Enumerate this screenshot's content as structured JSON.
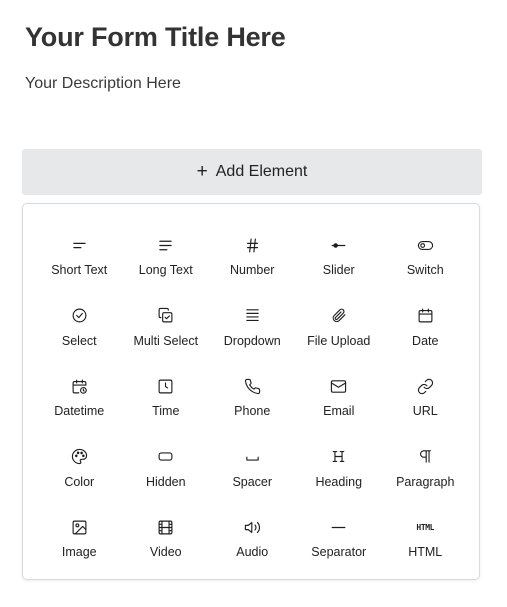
{
  "form": {
    "title": "Your Form Title Here",
    "description": "Your Description Here"
  },
  "add_element": {
    "icon": "plus-icon",
    "label": "Add Element",
    "background": "#e6e8e9"
  },
  "elements": [
    {
      "key": "short-text",
      "label": "Short Text",
      "icon": "short-text-icon"
    },
    {
      "key": "long-text",
      "label": "Long Text",
      "icon": "long-text-icon"
    },
    {
      "key": "number",
      "label": "Number",
      "icon": "hash-icon"
    },
    {
      "key": "slider",
      "label": "Slider",
      "icon": "slider-icon"
    },
    {
      "key": "switch",
      "label": "Switch",
      "icon": "toggle-icon"
    },
    {
      "key": "select",
      "label": "Select",
      "icon": "circle-check-icon"
    },
    {
      "key": "multi-select",
      "label": "Multi Select",
      "icon": "copy-check-icon"
    },
    {
      "key": "dropdown",
      "label": "Dropdown",
      "icon": "stacked-lines-icon"
    },
    {
      "key": "file-upload",
      "label": "File Upload",
      "icon": "paperclip-icon"
    },
    {
      "key": "date",
      "label": "Date",
      "icon": "calendar-icon"
    },
    {
      "key": "datetime",
      "label": "Datetime",
      "icon": "calendar-clock-icon"
    },
    {
      "key": "time",
      "label": "Time",
      "icon": "clock-square-icon"
    },
    {
      "key": "phone",
      "label": "Phone",
      "icon": "phone-icon"
    },
    {
      "key": "email",
      "label": "Email",
      "icon": "mail-icon"
    },
    {
      "key": "url",
      "label": "URL",
      "icon": "link-icon"
    },
    {
      "key": "color",
      "label": "Color",
      "icon": "palette-icon"
    },
    {
      "key": "hidden",
      "label": "Hidden",
      "icon": "rounded-rect-icon"
    },
    {
      "key": "spacer",
      "label": "Spacer",
      "icon": "space-icon"
    },
    {
      "key": "heading",
      "label": "Heading",
      "icon": "heading-icon"
    },
    {
      "key": "paragraph",
      "label": "Paragraph",
      "icon": "pilcrow-icon"
    },
    {
      "key": "image",
      "label": "Image",
      "icon": "image-icon"
    },
    {
      "key": "video",
      "label": "Video",
      "icon": "film-icon"
    },
    {
      "key": "audio",
      "label": "Audio",
      "icon": "volume-icon"
    },
    {
      "key": "separator",
      "label": "Separator",
      "icon": "minus-icon"
    },
    {
      "key": "html",
      "label": "HTML",
      "icon": "html-icon",
      "glyph": "HTML"
    }
  ]
}
